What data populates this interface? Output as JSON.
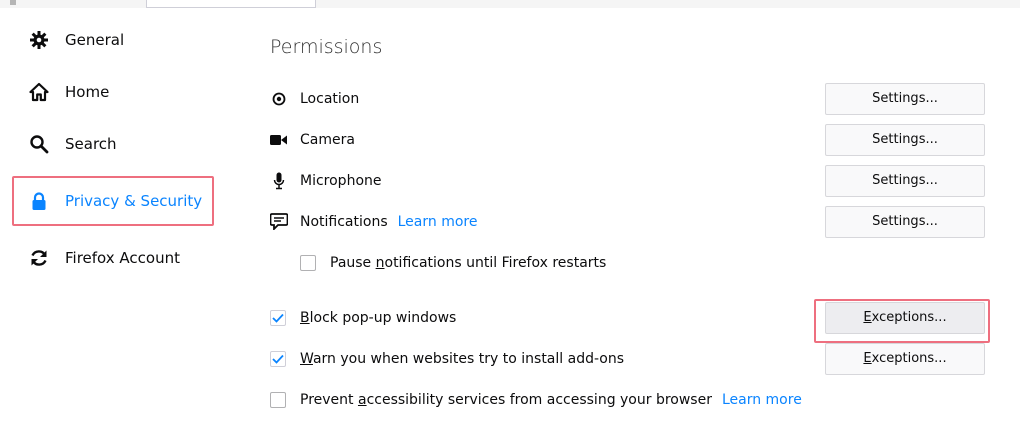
{
  "sidebar": {
    "items": [
      {
        "label": "General",
        "icon": "gear-icon"
      },
      {
        "label": "Home",
        "icon": "home-icon"
      },
      {
        "label": "Search",
        "icon": "search-icon"
      },
      {
        "label": "Privacy & Security",
        "icon": "lock-icon",
        "selected": true
      },
      {
        "label": "Firefox Account",
        "icon": "sync-icon"
      }
    ]
  },
  "permissions": {
    "title": "Permissions",
    "location": {
      "label": "Location",
      "button": "Settings..."
    },
    "camera": {
      "label": "Camera",
      "button": "Settings..."
    },
    "microphone": {
      "label": "Microphone",
      "button": "Settings..."
    },
    "notifications": {
      "label": "Notifications",
      "link": "Learn more",
      "button": "Settings..."
    },
    "pause_notifications": {
      "label_pre": "Pause ",
      "label_u": "n",
      "label_post": "otifications until Firefox restarts",
      "checked": false
    },
    "block_popups": {
      "label_u": "B",
      "label_post": "lock pop-up windows",
      "checked": true,
      "button_u": "E",
      "button_post": "xceptions..."
    },
    "warn_addons": {
      "label_u": "W",
      "label_post": "arn you when websites try to install add-ons",
      "checked": true,
      "button_u": "E",
      "button_post": "xceptions..."
    },
    "prevent_accessibility": {
      "label_pre": "Prevent ",
      "label_u": "a",
      "label_post": "ccessibility services from accessing your browser",
      "link": "Learn more",
      "checked": false
    }
  },
  "colors": {
    "accent": "#0a84ff",
    "highlight": "#ee6f7f"
  }
}
